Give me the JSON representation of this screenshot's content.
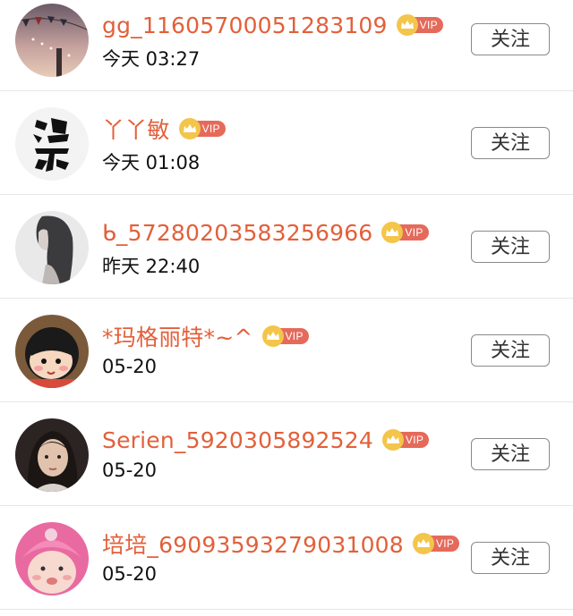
{
  "follow_list": [
    {
      "name": "gg_11605700051283109",
      "time": "今天 03:27",
      "vip_label": "VIP",
      "button_label": "关注",
      "avatar": "avatar-festive-lights"
    },
    {
      "name": "丫丫敏",
      "time": "今天 01:08",
      "vip_label": "VIP",
      "button_label": "关注",
      "avatar": "avatar-calligraphy"
    },
    {
      "name": "ᑲ_57280203583256966",
      "time": "昨天 22:40",
      "vip_label": "VIP",
      "button_label": "关注",
      "avatar": "avatar-girl-profile"
    },
    {
      "name": "*玛格丽特*~^",
      "time": "05-20",
      "vip_label": "VIP",
      "button_label": "关注",
      "avatar": "avatar-cartoon-girl"
    },
    {
      "name": "Serien_5920305892524",
      "time": "05-20",
      "vip_label": "VIP",
      "button_label": "关注",
      "avatar": "avatar-woman-portrait"
    },
    {
      "name": "培培_69093593279031008",
      "time": "05-20",
      "vip_label": "VIP",
      "button_label": "关注",
      "avatar": "avatar-baby-pink-hat"
    }
  ],
  "colors": {
    "name": "#e2603a",
    "vip_badge": "#e56a5a",
    "crown": "#f3c54a",
    "divider": "#e6e6e6"
  }
}
